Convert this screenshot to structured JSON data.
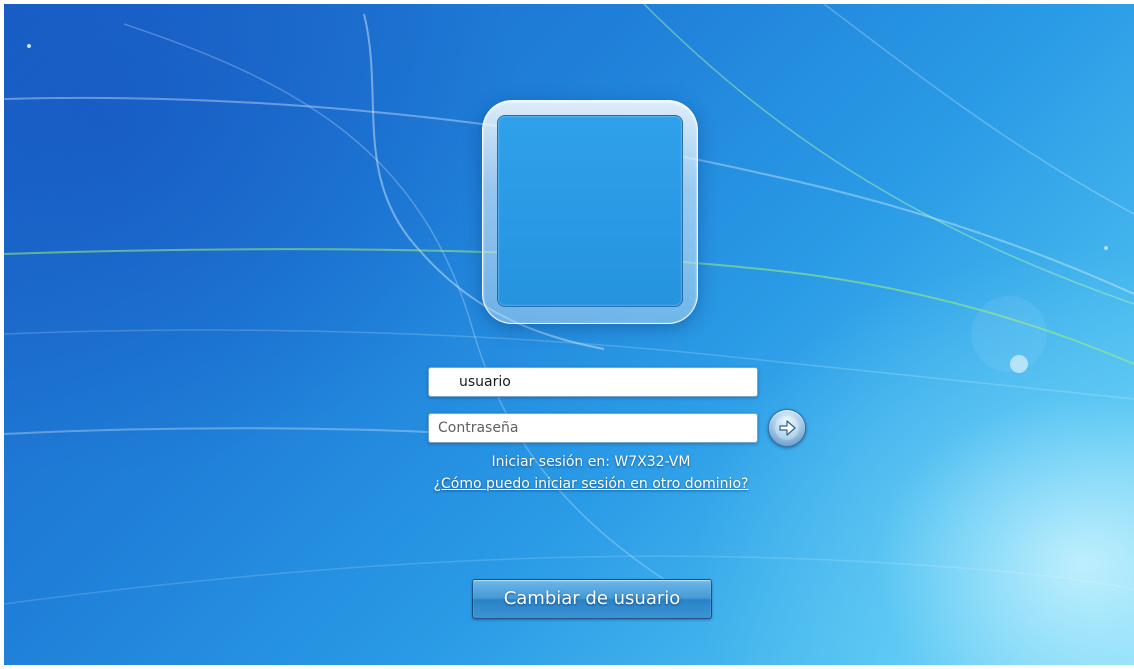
{
  "login": {
    "username_value": "usuario",
    "password_placeholder": "Contraseña",
    "submit_icon": "arrow-right-icon",
    "login_target": "Iniciar sesión en: W7X32-VM",
    "domain_link": "¿Cómo puedo iniciar sesión en otro dominio?",
    "switch_user_label": "Cambiar de usuario"
  },
  "avatar": {
    "icon": "user-picture-frame"
  },
  "colors": {
    "background_dark": "#1b63c6",
    "background_light": "#86dcf8",
    "text": "#ffffff"
  }
}
